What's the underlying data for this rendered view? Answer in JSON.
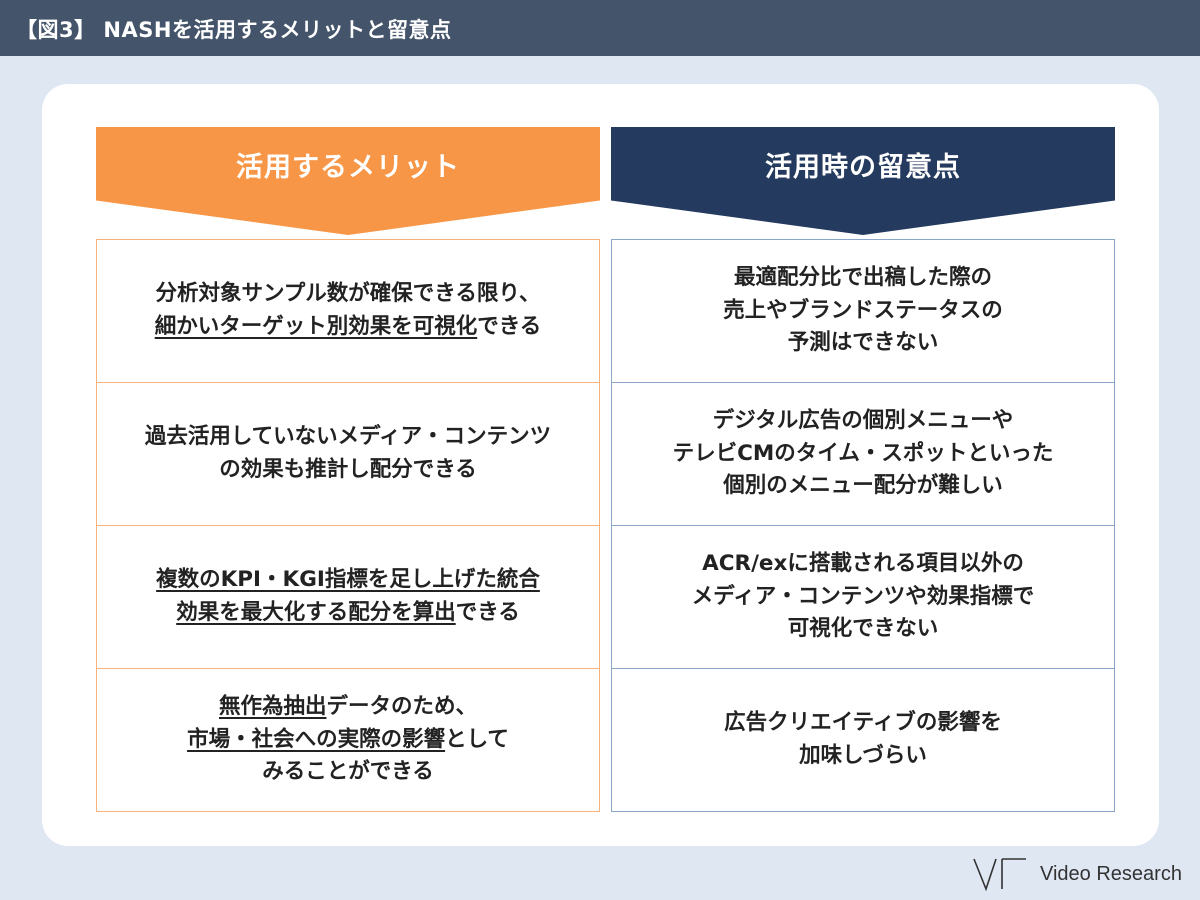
{
  "header": {
    "title": "【図3】 NASHを活用するメリットと留意点"
  },
  "columns": {
    "merits": {
      "heading": "活用するメリット",
      "items": [
        {
          "parts": [
            {
              "text": "分析対象サンプル数が確保できる限り、\n",
              "underline": false
            },
            {
              "text": "細かいターゲット別効果を可視化",
              "underline": true
            },
            {
              "text": "できる",
              "underline": false
            }
          ]
        },
        {
          "parts": [
            {
              "text": "過去活用していないメディア・コンテンツ\nの効果も推計し配分できる",
              "underline": false
            }
          ]
        },
        {
          "parts": [
            {
              "text": "複数のKPI・KGI指標を足し上げた統合\n効果を最大化する配分を算出",
              "underline": true
            },
            {
              "text": "できる",
              "underline": false
            }
          ]
        },
        {
          "parts": [
            {
              "text": "無作為抽出",
              "underline": true
            },
            {
              "text": "データのため、\n",
              "underline": false
            },
            {
              "text": "市場・社会への実際の影響",
              "underline": true
            },
            {
              "text": "として\nみることができる",
              "underline": false
            }
          ]
        }
      ]
    },
    "cautions": {
      "heading": "活用時の留意点",
      "items": [
        {
          "parts": [
            {
              "text": "最適配分比で出稿した際の\n売上やブランドステータスの\n予測はできない",
              "underline": false
            }
          ]
        },
        {
          "parts": [
            {
              "text": "デジタル広告の個別メニューや\nテレビCMのタイム・スポットといった\n個別のメニュー配分が難しい",
              "underline": false
            }
          ]
        },
        {
          "parts": [
            {
              "text": "ACR/exに搭載される項目以外の\nメディア・コンテンツや効果指標で\n可視化できない",
              "underline": false
            }
          ]
        },
        {
          "parts": [
            {
              "text": "広告クリエイティブの影響を\n加味しづらい",
              "underline": false
            }
          ]
        }
      ]
    }
  },
  "footer": {
    "logo_text": "Video Research",
    "logo_icon": "video-research-logo-icon"
  },
  "colors": {
    "topbar": "#44546a",
    "merits_accent": "#f79646",
    "cautions_accent": "#243a5e",
    "background": "#dfe7f2"
  }
}
